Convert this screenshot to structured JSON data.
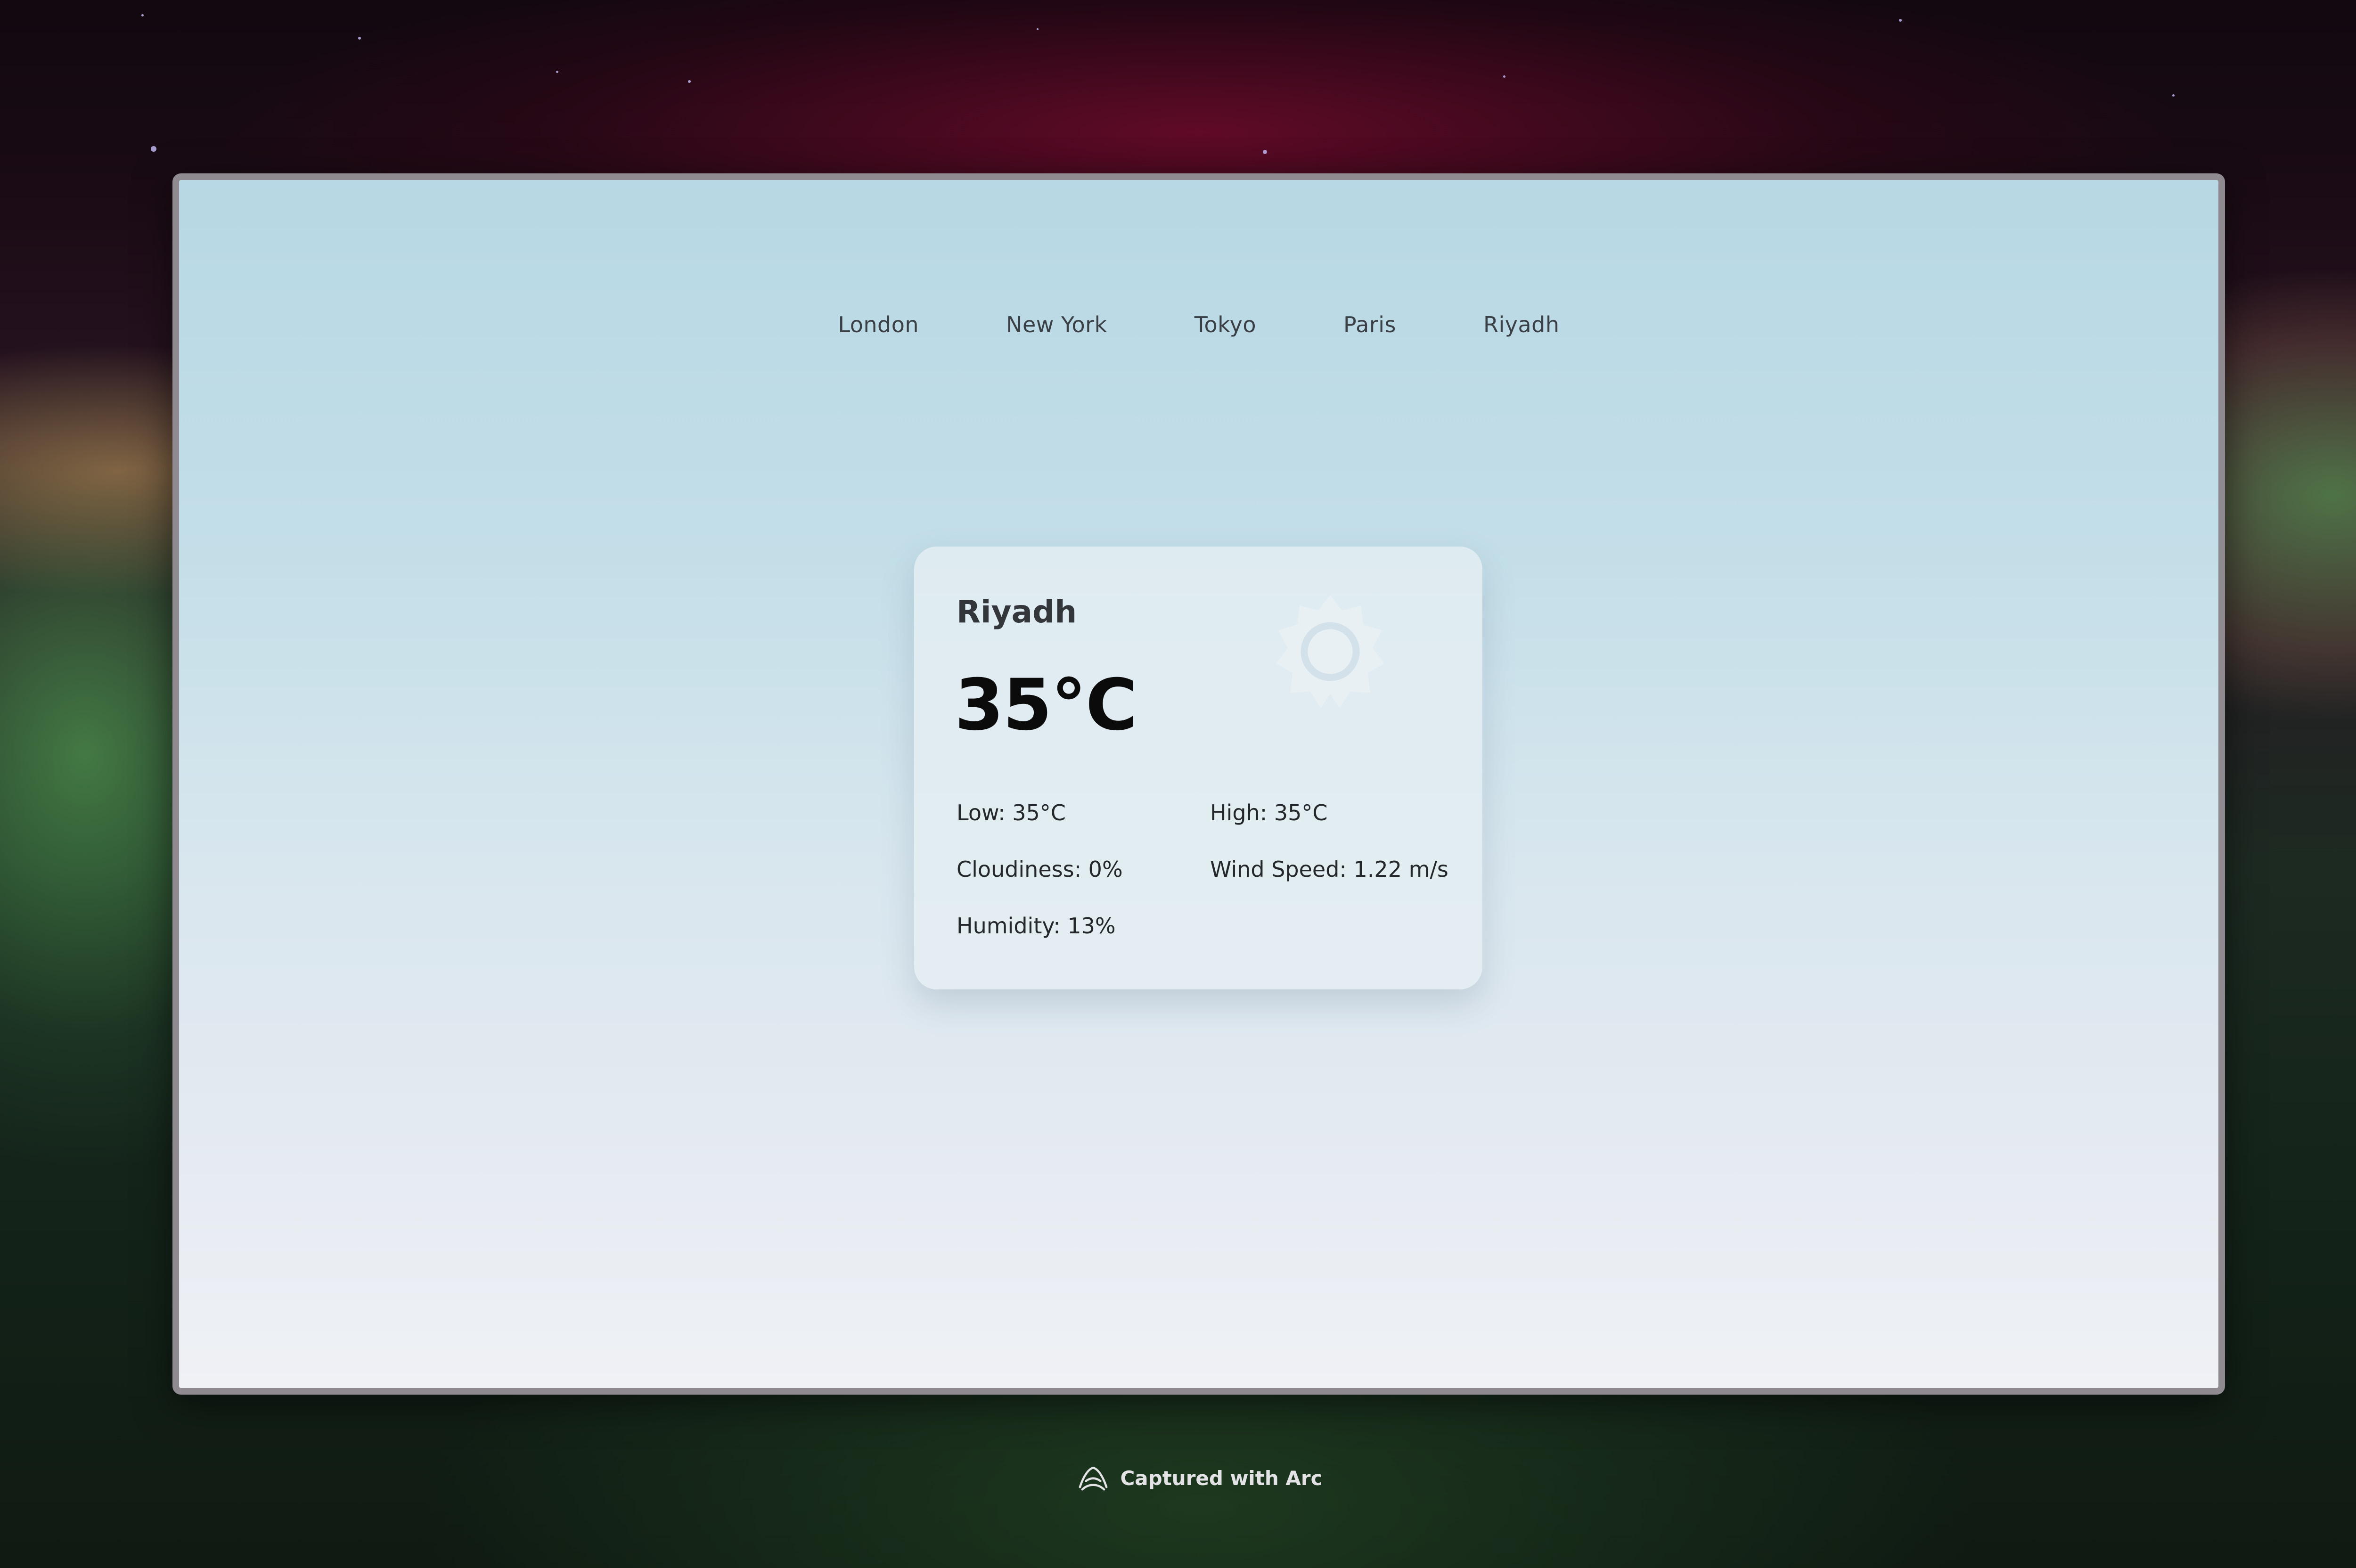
{
  "nav": {
    "cities": [
      "London",
      "New York",
      "Tokyo",
      "Paris",
      "Riyadh"
    ]
  },
  "weather": {
    "city": "Riyadh",
    "temperature": "35°C",
    "condition_icon": "sun-icon",
    "low": "Low: 35°C",
    "high": "High: 35°C",
    "cloudiness": "Cloudiness: 0%",
    "wind_speed": "Wind Speed: 1.22 m/s",
    "humidity": "Humidity: 13%"
  },
  "footer": {
    "caption": "Captured with Arc",
    "icon": "arc-logo-icon"
  },
  "colors": {
    "frame_bg_top": "#b7d8e4",
    "frame_bg_bottom": "#eff1f5",
    "card_bg": "#e4eef3",
    "sun_icon": "#e8f0f4"
  }
}
